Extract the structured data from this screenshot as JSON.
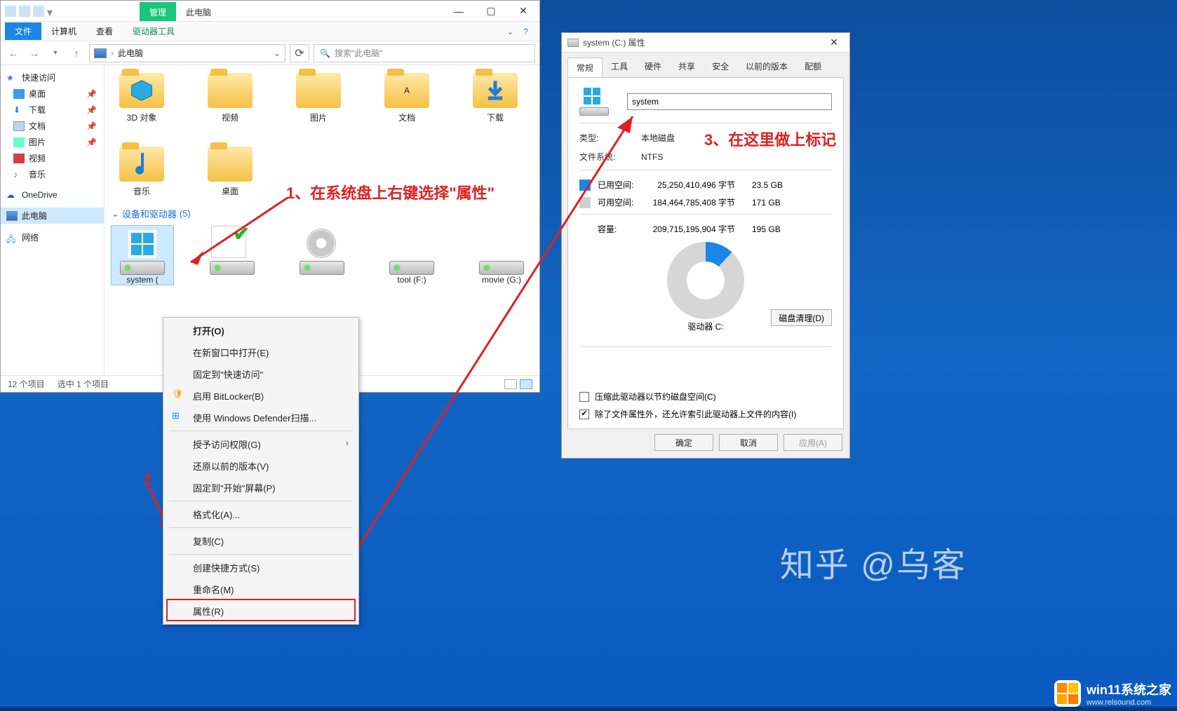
{
  "explorer": {
    "title_tabs": {
      "manage": "管理",
      "this_pc": "此电脑",
      "drive_tools": "驱动器工具"
    },
    "ribbon": {
      "file": "文件",
      "computer": "计算机",
      "view": "查看"
    },
    "address": {
      "location": "此电脑"
    },
    "search": {
      "placeholder": "搜索\"此电脑\""
    },
    "sidebar": {
      "quick": "快速访问",
      "desktop": "桌面",
      "download": "下载",
      "docs": "文档",
      "pics": "图片",
      "video": "视频",
      "music": "音乐",
      "onedrive": "OneDrive",
      "this_pc": "此电脑",
      "network": "网络"
    },
    "folders": {
      "obj3d": "3D 对象",
      "video": "视频",
      "pics": "图片",
      "docs": "文档",
      "download": "下载",
      "music": "音乐",
      "desktop": "桌面"
    },
    "section": {
      "label": "设备和驱动器",
      "count": "(5)"
    },
    "drives": {
      "system": "system (",
      "tool": "tool (F:)",
      "movie": "movie (G:)"
    },
    "status": {
      "items": "12 个项目",
      "selected": "选中 1 个项目"
    }
  },
  "context_menu": {
    "open": "打开(O)",
    "open_new": "在新窗口中打开(E)",
    "pin_quick": "固定到\"快速访问\"",
    "bitlocker": "启用 BitLocker(B)",
    "defender": "使用 Windows Defender扫描...",
    "grant": "授予访问权限(G)",
    "restore": "还原以前的版本(V)",
    "pin_start": "固定到\"开始\"屏幕(P)",
    "format": "格式化(A)...",
    "copy": "复制(C)",
    "shortcut": "创建快捷方式(S)",
    "rename": "重命名(M)",
    "properties": "属性(R)"
  },
  "properties": {
    "title": "system (C:) 属性",
    "tabs": {
      "general": "常规",
      "tools": "工具",
      "hardware": "硬件",
      "sharing": "共享",
      "security": "安全",
      "prev": "以前的版本",
      "quota": "配额"
    },
    "name_value": "system",
    "type_lbl": "类型:",
    "type_val": "本地磁盘",
    "fs_lbl": "文件系统:",
    "fs_val": "NTFS",
    "used_lbl": "已用空间:",
    "used_bytes": "25,250,410,496 字节",
    "used_gb": "23.5 GB",
    "free_lbl": "可用空间:",
    "free_bytes": "184,464,785,408 字节",
    "free_gb": "171 GB",
    "cap_lbl": "容量:",
    "cap_bytes": "209,715,195,904 字节",
    "cap_gb": "195 GB",
    "drive_label": "驱动器 C:",
    "cleanup": "磁盘清理(D)",
    "compress": "压缩此驱动器以节约磁盘空间(C)",
    "index": "除了文件属性外，还允许索引此驱动器上文件的内容(I)",
    "ok": "确定",
    "cancel": "取消",
    "apply": "应用(A)"
  },
  "annotations": {
    "a1": "1、在系统盘上右键选择\"属性\"",
    "a2": "2",
    "a3": "3、在这里做上标记"
  },
  "watermark": {
    "zhihu": "知乎 @乌客",
    "site": "win11系统之家",
    "url": "www.relsound.com"
  }
}
